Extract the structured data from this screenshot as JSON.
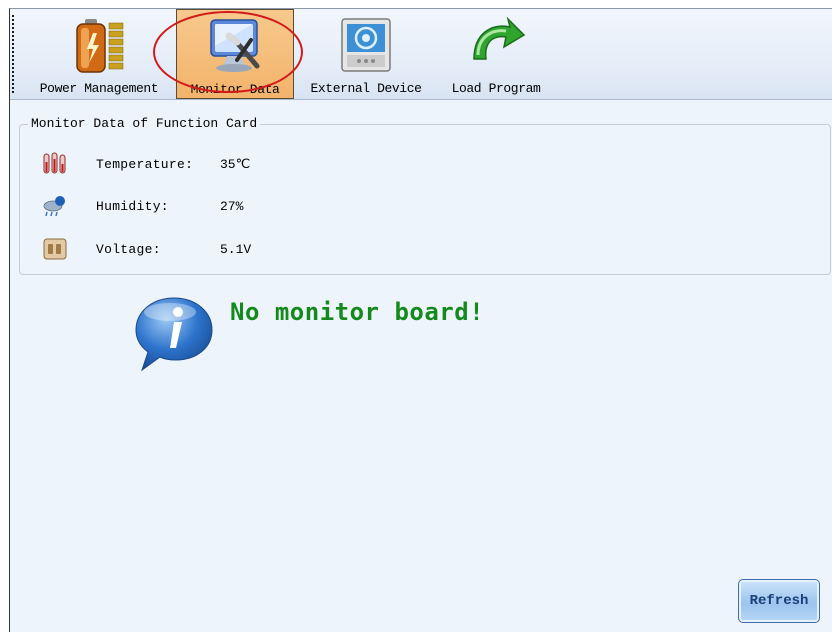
{
  "toolbar": {
    "items": [
      {
        "label": "Power Management",
        "icon": "battery-icon"
      },
      {
        "label": "Monitor Data",
        "icon": "monitor-tools-icon",
        "selected": true
      },
      {
        "label": "External Device",
        "icon": "external-device-icon"
      },
      {
        "label": "Load Program",
        "icon": "load-arrow-icon"
      }
    ]
  },
  "monitor_group": {
    "title": "Monitor Data of Function Card",
    "rows": [
      {
        "label": "Temperature:",
        "value": "35℃",
        "icon": "thermometer-icon"
      },
      {
        "label": "Humidity:",
        "value": "27%",
        "icon": "humidity-icon"
      },
      {
        "label": "Voltage:",
        "value": "5.1V",
        "icon": "voltage-icon"
      }
    ]
  },
  "message": "No monitor board!",
  "refresh_label": "Refresh",
  "colors": {
    "message": "#138a1b",
    "highlight": "#d21a1a",
    "selected_tab": "#f3b36a",
    "panel_bg": "#eef4fb"
  }
}
